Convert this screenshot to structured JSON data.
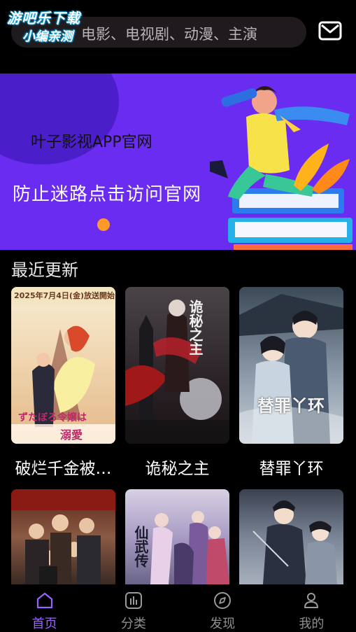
{
  "watermark": {
    "line1": "游吧乐下载",
    "line2": "小编亲测"
  },
  "search": {
    "placeholder": "电影、电视剧、动漫、主演"
  },
  "header": {
    "mail_icon": "mail-icon"
  },
  "banner": {
    "title": "叶子影视APP官网",
    "subtitle": "防止迷路点击访问官网",
    "colors": {
      "background": "#6a2cf0",
      "blob": "#4a1ec8"
    }
  },
  "section": {
    "title": "最近更新",
    "items": [
      {
        "title": "破烂千金被…",
        "poster_text": "ずたぼろ令嬢は",
        "poster_sub": "2025年7月4日(金)放送開始",
        "poster_sub2": "溺愛",
        "colors": [
          "#f6e7c9",
          "#e2b98a"
        ]
      },
      {
        "title": "诡秘之主",
        "poster_text": "诡秘之主",
        "colors": [
          "#3a3438",
          "#7a1a1a"
        ]
      },
      {
        "title": "替罪丫环",
        "poster_text": "替罪丫环",
        "colors": [
          "#5a6a7a",
          "#b9c3cc"
        ]
      },
      {
        "title": "",
        "poster_text": "",
        "colors": [
          "#4a2a20",
          "#a06040"
        ]
      },
      {
        "title": "",
        "poster_text": "仙武传",
        "colors": [
          "#c9c3d8",
          "#6a6488"
        ]
      },
      {
        "title": "",
        "poster_text": "",
        "colors": [
          "#6a7488",
          "#2a3040"
        ]
      }
    ]
  },
  "bottom_nav": {
    "items": [
      {
        "label": "首页",
        "icon": "home-icon",
        "active": true
      },
      {
        "label": "分类",
        "icon": "category-icon",
        "active": false
      },
      {
        "label": "发现",
        "icon": "compass-icon",
        "active": false
      },
      {
        "label": "我的",
        "icon": "user-icon",
        "active": false
      }
    ],
    "active_color": "#9a64ff"
  }
}
